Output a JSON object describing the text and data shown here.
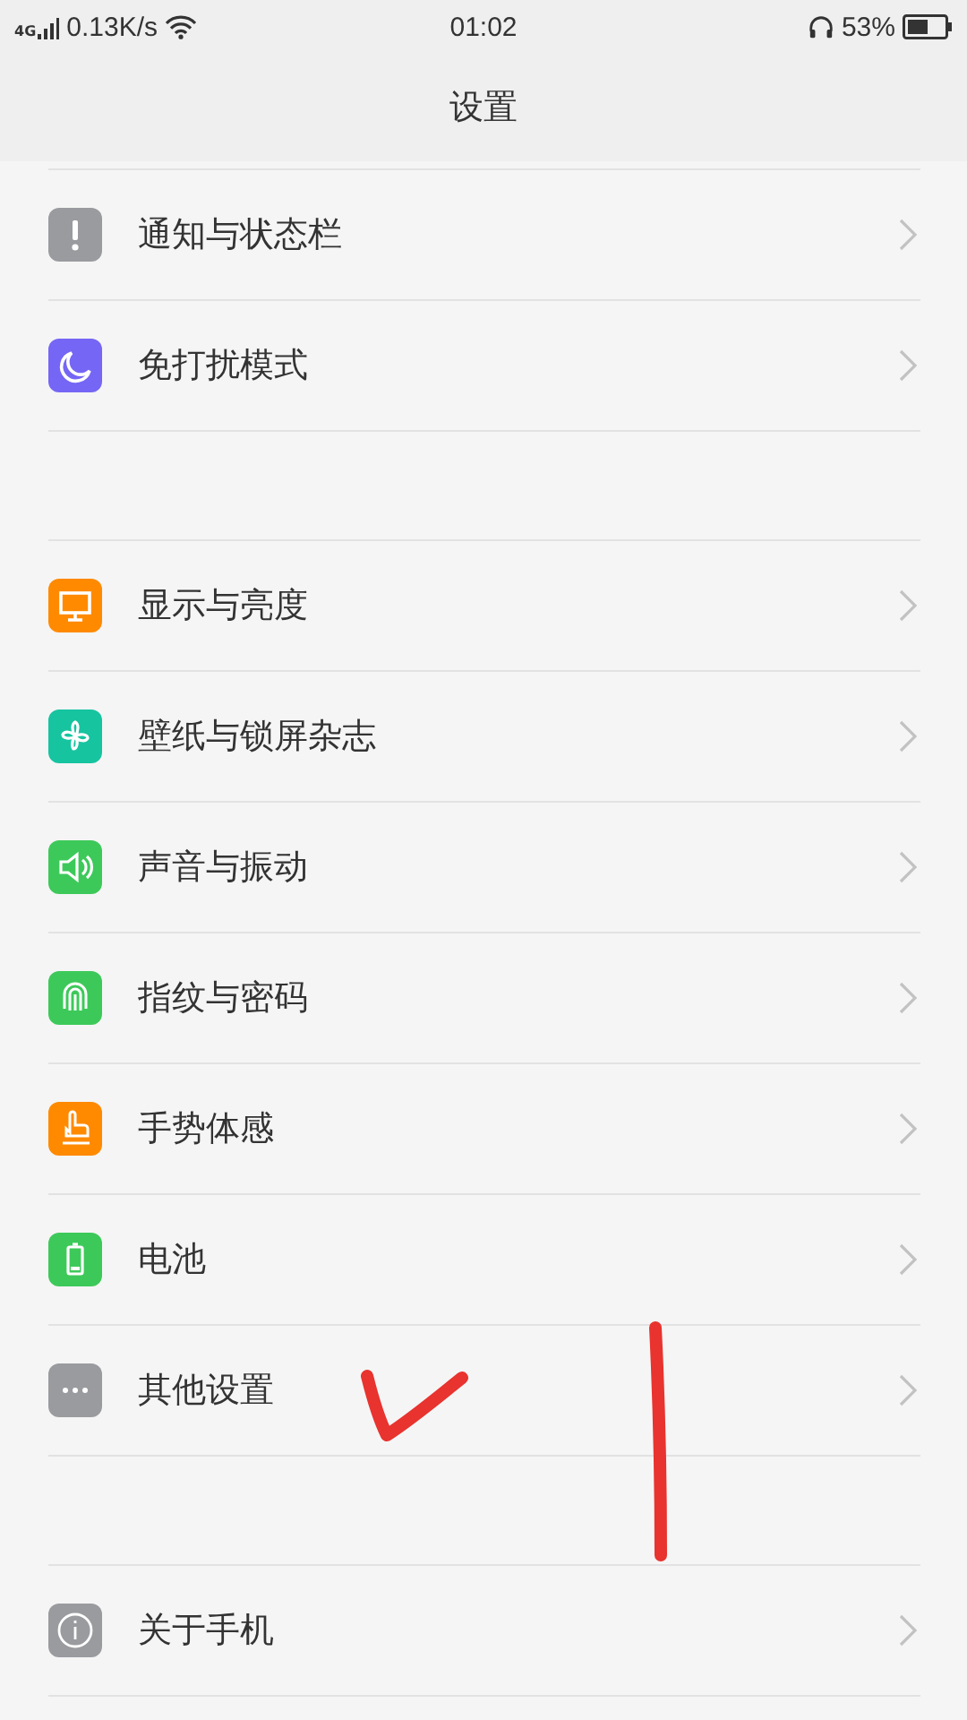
{
  "status_bar": {
    "network_type": "4G",
    "speed": "0.13K/s",
    "time": "01:02",
    "battery": "53%"
  },
  "header": {
    "title": "设置"
  },
  "groups": [
    {
      "items": [
        {
          "label": "通知与状态栏",
          "kind": "exclaim",
          "color": "#9a9b9f"
        },
        {
          "label": "免打扰模式",
          "kind": "moon",
          "color": "#7566f5"
        }
      ]
    },
    {
      "items": [
        {
          "label": "显示与亮度",
          "kind": "monitor",
          "color": "#ff8a00"
        },
        {
          "label": "壁纸与锁屏杂志",
          "kind": "flower",
          "color": "#16c4a0"
        },
        {
          "label": "声音与振动",
          "kind": "speaker",
          "color": "#3dc95a"
        },
        {
          "label": "指纹与密码",
          "kind": "fingerprint",
          "color": "#3dc95a"
        },
        {
          "label": "手势体感",
          "kind": "hand",
          "color": "#ff8a00"
        },
        {
          "label": "电池",
          "kind": "battery",
          "color": "#3dc95a"
        },
        {
          "label": "其他设置",
          "kind": "dots",
          "color": "#9a9b9f"
        }
      ]
    },
    {
      "items": [
        {
          "label": "关于手机",
          "kind": "info",
          "color": "#9a9b9f"
        }
      ]
    }
  ],
  "annotations": [
    {
      "kind": "check",
      "color": "#e8332f"
    },
    {
      "kind": "line",
      "color": "#e8332f"
    }
  ]
}
